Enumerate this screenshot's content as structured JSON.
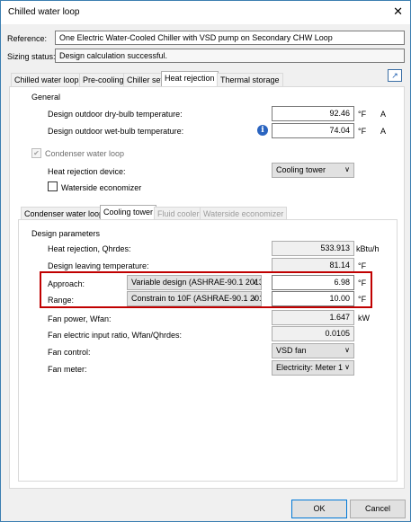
{
  "window": {
    "title": "Chilled water loop",
    "close_icon": "close-icon"
  },
  "reference": {
    "label": "Reference:",
    "value": "One Electric Water-Cooled Chiller with VSD pump on Secondary CHW Loop"
  },
  "sizing": {
    "label": "Sizing status:",
    "value": "Design calculation successful."
  },
  "main_tabs": [
    "Chilled water loop",
    "Pre-cooling",
    "Chiller set",
    "Heat rejection",
    "Thermal storage"
  ],
  "general": {
    "title": "General",
    "dry_bulb": {
      "label": "Design outdoor dry-bulb temperature:",
      "value": "92.46",
      "unit": "°F",
      "suffix": "A"
    },
    "wet_bulb": {
      "label": "Design outdoor wet-bulb temperature:",
      "value": "74.04",
      "unit": "°F",
      "suffix": "A"
    }
  },
  "condenser_loop": {
    "label": "Condenser water loop",
    "check_mark": "✔"
  },
  "heat_rejection_device": {
    "label": "Heat rejection device:",
    "value": "Cooling tower"
  },
  "waterside_economizer": {
    "label": "Waterside economizer"
  },
  "sub_tabs": [
    "Condenser water loop",
    "Cooling tower",
    "Fluid cooler",
    "Waterside economizer"
  ],
  "design": {
    "title": "Design parameters",
    "heat_rejection": {
      "label": "Heat rejection, Qhrdes:",
      "value": "533.913",
      "unit": "kBtu/h"
    },
    "leaving_temp": {
      "label": "Design leaving temperature:",
      "value": "81.14",
      "unit": "°F"
    },
    "approach": {
      "label": "Approach:",
      "option": "Variable design (ASHRAE-90.1 2013",
      "value": "6.98",
      "unit": "°F"
    },
    "range": {
      "label": "Range:",
      "option": "Constrain to 10F (ASHRAE-90.1 201",
      "value": "10.00",
      "unit": "°F"
    },
    "fan_power": {
      "label": "Fan power, Wfan:",
      "value": "1.647",
      "unit": "kW"
    },
    "fan_ratio": {
      "label": "Fan electric input ratio, Wfan/Qhrdes:",
      "value": "0.0105"
    },
    "fan_control": {
      "label": "Fan control:",
      "value": "VSD fan"
    },
    "fan_meter": {
      "label": "Fan meter:",
      "value": "Electricity: Meter 1"
    }
  },
  "buttons": {
    "ok": "OK",
    "cancel": "Cancel"
  },
  "dropdown_arrow": "∨"
}
